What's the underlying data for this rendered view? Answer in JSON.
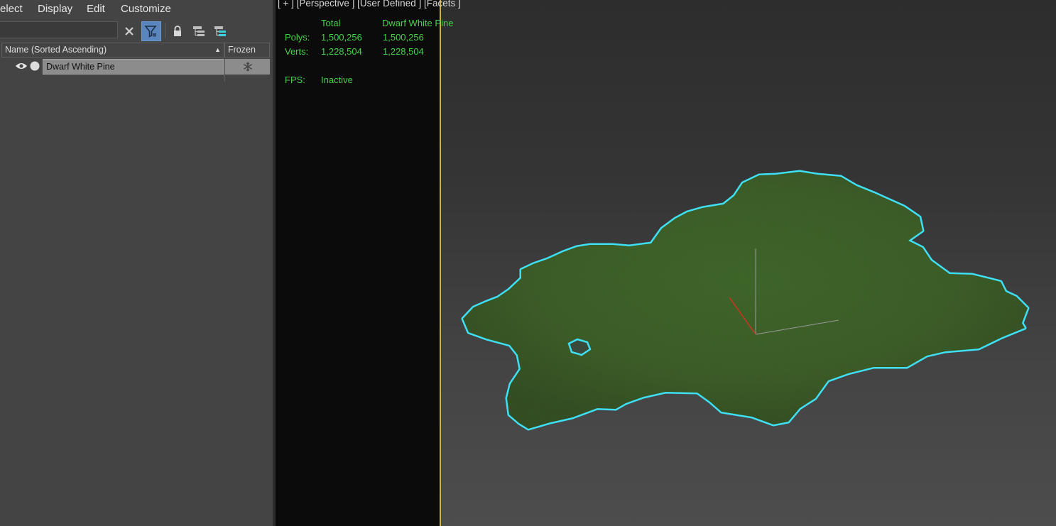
{
  "menu": {
    "items": [
      "elect",
      "Display",
      "Edit",
      "Customize"
    ]
  },
  "toolbar": {
    "search_value": "",
    "icons": [
      "clear-x-icon",
      "filter-icon",
      "lock-icon",
      "hierarchy-icon",
      "layer-hierarchy-icon"
    ]
  },
  "explorer": {
    "columns": {
      "name": "Name (Sorted Ascending)",
      "frozen": "Frozen"
    },
    "rows": [
      {
        "name": "Dwarf White Pine",
        "visible": true,
        "frozen": false
      }
    ]
  },
  "viewport": {
    "label": "[ + ] [Perspective ] [User Defined ] [Facets ]",
    "stats": {
      "col_total": "Total",
      "col_object": "Dwarf White Pine",
      "polys_label": "Polys:",
      "polys_total": "1,500,256",
      "polys_object": "1,500,256",
      "verts_label": "Verts:",
      "verts_total": "1,228,504",
      "verts_object": "1,228,504",
      "fps_label": "FPS:",
      "fps_value": "Inactive"
    }
  },
  "colors": {
    "stats_text": "#46d24a",
    "selection_outline": "#3fe0f5",
    "viewport_border": "#c8b441",
    "filter_active": "#5a86c0"
  }
}
